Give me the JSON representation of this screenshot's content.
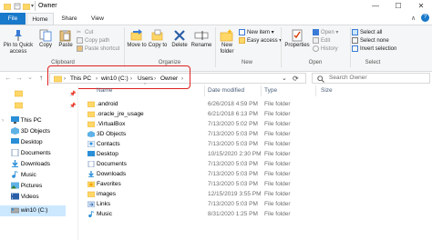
{
  "window": {
    "title": "Owner",
    "min_glyph": "—",
    "max_glyph": "☐",
    "close_glyph": "✕",
    "ribbon_collapse_glyph": "∧",
    "help_glyph": "?"
  },
  "tabs": {
    "file": "File",
    "items": [
      "Home",
      "Share",
      "View"
    ]
  },
  "ribbon": {
    "clipboard": {
      "group_label": "Clipboard",
      "pin_label": "Pin to Quick access",
      "copy_label": "Copy",
      "paste_label": "Paste",
      "cut_label": "Cut",
      "copy_path_label": "Copy path",
      "paste_shortcut_label": "Paste shortcut"
    },
    "organize": {
      "group_label": "Organize",
      "move_to_label": "Move to",
      "copy_to_label": "Copy to",
      "delete_label": "Delete",
      "rename_label": "Rename"
    },
    "new": {
      "group_label": "New",
      "new_folder_label": "New folder",
      "new_item_label": "New item ▾",
      "easy_access_label": "Easy access ▾"
    },
    "open": {
      "group_label": "Open",
      "properties_label": "Properties",
      "open_label": "Open ▾",
      "edit_label": "Edit",
      "history_label": "History"
    },
    "select": {
      "group_label": "Select",
      "select_all_label": "Select all",
      "select_none_label": "Select none",
      "invert_label": "Invert selection"
    }
  },
  "navbar": {
    "back": "←",
    "forward": "→",
    "dropdown": "⌄",
    "up": "↑",
    "path": [
      "This PC",
      "win10 (C:)",
      "Users",
      "Owner"
    ],
    "sep": "›",
    "refresh": "⟳",
    "search_placeholder": "Search Owner"
  },
  "nav_pane": {
    "items": [
      {
        "label": "",
        "pinned": true
      },
      {
        "label": "",
        "pinned": true
      },
      {
        "label": "This PC",
        "pinned": false
      },
      {
        "label": "3D Objects",
        "pinned": false
      },
      {
        "label": "Desktop",
        "pinned": false
      },
      {
        "label": "Documents",
        "pinned": false
      },
      {
        "label": "Downloads",
        "pinned": false
      },
      {
        "label": "Music",
        "pinned": false
      },
      {
        "label": "Pictures",
        "pinned": false
      },
      {
        "label": "Videos",
        "pinned": false
      },
      {
        "label": "win10 (C:)",
        "pinned": false
      }
    ]
  },
  "columns": {
    "name": "Name",
    "date": "Date modified",
    "type": "Type",
    "size": "Size",
    "sort_glyph": "^"
  },
  "files": [
    {
      "name": ".android",
      "date": "6/26/2018 4:59 PM",
      "type": "File folder",
      "icon": "folder"
    },
    {
      "name": ".oracle_jre_usage",
      "date": "6/21/2018 6:13 PM",
      "type": "File folder",
      "icon": "folder"
    },
    {
      "name": ".VirtualBox",
      "date": "7/13/2020 5:02 PM",
      "type": "File folder",
      "icon": "folder"
    },
    {
      "name": "3D Objects",
      "date": "7/13/2020 5:03 PM",
      "type": "File folder",
      "icon": "3d"
    },
    {
      "name": "Contacts",
      "date": "7/13/2020 5:03 PM",
      "type": "File folder",
      "icon": "contacts"
    },
    {
      "name": "Desktop",
      "date": "10/15/2020 2:30 PM",
      "type": "File folder",
      "icon": "desktop"
    },
    {
      "name": "Documents",
      "date": "7/13/2020 5:03 PM",
      "type": "File folder",
      "icon": "documents"
    },
    {
      "name": "Downloads",
      "date": "7/13/2020 5:03 PM",
      "type": "File folder",
      "icon": "downloads"
    },
    {
      "name": "Favorites",
      "date": "7/13/2020 5:03 PM",
      "type": "File folder",
      "icon": "favorites"
    },
    {
      "name": "images",
      "date": "12/15/2019 3:55 PM",
      "type": "File folder",
      "icon": "folder"
    },
    {
      "name": "Links",
      "date": "7/13/2020 5:03 PM",
      "type": "File folder",
      "icon": "links"
    },
    {
      "name": "Music",
      "date": "8/31/2020 1:25 PM",
      "type": "File folder",
      "icon": "music"
    }
  ],
  "colors": {
    "file_tab": "#1979ca",
    "folder": "#ffd766",
    "folder_dark": "#e7b13c",
    "highlight_box": "#e02020",
    "selected": "#cce8ff"
  }
}
